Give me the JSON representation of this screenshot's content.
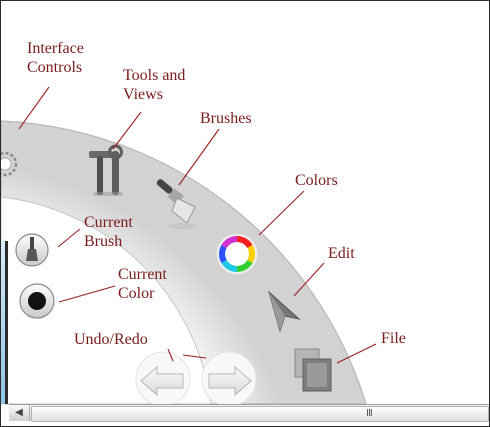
{
  "labels": {
    "interface_controls": [
      "Interface",
      "Controls"
    ],
    "tools_and_views": [
      "Tools and",
      "Views"
    ],
    "brushes": "Brushes",
    "colors": "Colors",
    "current_brush": [
      "Current",
      "Brush"
    ],
    "current_color": [
      "Current",
      "Color"
    ],
    "edit": "Edit",
    "undo_redo": "Undo/Redo",
    "file": "File"
  },
  "icons": {
    "interface_controls": "gear-icon",
    "tools_and_views": "hammer-wrench-icon",
    "brushes": "paint-brush-icon",
    "colors": "color-wheel-icon",
    "edit": "pointer-arrow-icon",
    "file": "layered-pages-icon",
    "undo": "undo-arrow-icon",
    "redo": "redo-arrow-icon",
    "current_brush": "brush-preview-icon",
    "current_color": "color-swatch-icon"
  },
  "scrollbar": {
    "grip": "III",
    "left_arrow": "◀"
  },
  "colors": {
    "annotation": "#7a1a1a",
    "current_color": "#111111"
  }
}
